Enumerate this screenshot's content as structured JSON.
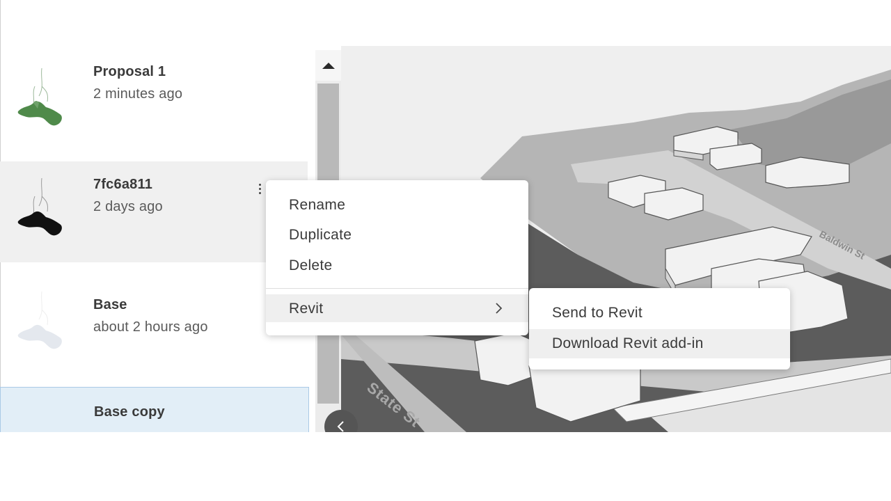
{
  "proposals": [
    {
      "name": "Proposal 1",
      "time": "2 minutes ago",
      "thumb_color": "#4f8a4a"
    },
    {
      "name": "7fc6a811",
      "time": "2 days ago",
      "thumb_color": "#111111"
    },
    {
      "name": "Base",
      "time": "about 2 hours ago",
      "thumb_color": "#e4e8ee"
    },
    {
      "name": "Base copy",
      "time": ""
    }
  ],
  "context_menu": {
    "rename": "Rename",
    "duplicate": "Duplicate",
    "delete": "Delete",
    "revit": "Revit"
  },
  "revit_submenu": {
    "send": "Send to Revit",
    "download": "Download Revit add-in"
  },
  "map_labels": {
    "state_st": "State St",
    "baldwin_st": "Baldwin St"
  },
  "colors": {
    "selected_bg": "#e2eef7",
    "hover_bg": "#f0f0f0",
    "menu_active": "#efefef"
  }
}
